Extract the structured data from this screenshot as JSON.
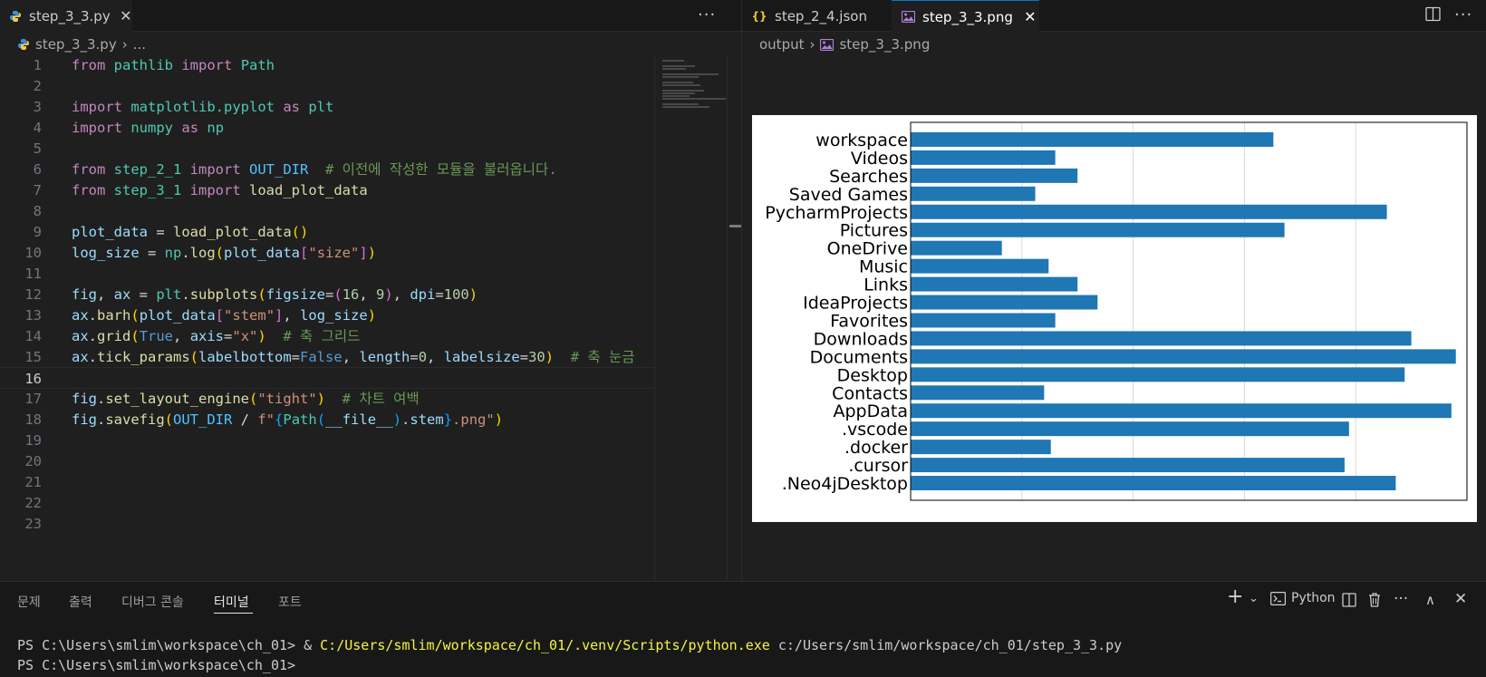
{
  "left_editor": {
    "tab": {
      "filename": "step_3_3.py",
      "icon": "python-file-icon",
      "close_glyph": "✕"
    },
    "more_actions": "···",
    "breadcrumb": {
      "file": "step_3_3.py",
      "trail": "..."
    },
    "lines": [
      {
        "n": "1"
      },
      {
        "n": "2"
      },
      {
        "n": "3"
      },
      {
        "n": "4"
      },
      {
        "n": "5"
      },
      {
        "n": "6"
      },
      {
        "n": "7"
      },
      {
        "n": "8"
      },
      {
        "n": "9"
      },
      {
        "n": "10"
      },
      {
        "n": "11"
      },
      {
        "n": "12"
      },
      {
        "n": "13"
      },
      {
        "n": "14"
      },
      {
        "n": "15"
      },
      {
        "n": "16"
      },
      {
        "n": "17"
      },
      {
        "n": "18"
      },
      {
        "n": "19"
      },
      {
        "n": "20"
      },
      {
        "n": "21"
      },
      {
        "n": "22"
      },
      {
        "n": "23"
      }
    ],
    "active_line": "16",
    "code": {
      "l1": [
        "from",
        " ",
        "pathlib",
        " ",
        "import",
        " ",
        "Path"
      ],
      "l3": [
        "import",
        " ",
        "matplotlib.pyplot",
        " ",
        "as",
        " ",
        "plt"
      ],
      "l4": [
        "import",
        " ",
        "numpy",
        " ",
        "as",
        " ",
        "np"
      ],
      "l6": [
        "from",
        " ",
        "step_2_1",
        " ",
        "import",
        " ",
        "OUT_DIR",
        "  ",
        "# 이전에 작성한 모듈을 불러옵니다."
      ],
      "l7": [
        "from",
        " ",
        "step_3_1",
        " ",
        "import",
        " ",
        "load_plot_data"
      ],
      "l9": [
        "plot_data",
        " = ",
        "load_plot_data",
        "(",
        ")"
      ],
      "l10": [
        "log_size",
        " = ",
        "np",
        ".",
        "log",
        "(",
        "plot_data",
        "[",
        "\"size\"",
        "]",
        ")"
      ],
      "l12": [
        "fig",
        ", ",
        "ax",
        " = ",
        "plt",
        ".",
        "subplots",
        "(",
        "figsize",
        "=",
        "(",
        "16",
        ", ",
        "9",
        ")",
        ", ",
        "dpi",
        "=",
        "100",
        ")"
      ],
      "l13": [
        "ax",
        ".",
        "barh",
        "(",
        "plot_data",
        "[",
        "\"stem\"",
        "]",
        ", ",
        "log_size",
        ")"
      ],
      "l14": [
        "ax",
        ".",
        "grid",
        "(",
        "True",
        ", ",
        "axis",
        "=",
        "\"x\"",
        ")",
        "  ",
        "# 축 그리드"
      ],
      "l15": [
        "ax",
        ".",
        "tick_params",
        "(",
        "labelbottom",
        "=",
        "False",
        ", ",
        "length",
        "=",
        "0",
        ", ",
        "labelsize",
        "=",
        "30",
        ")",
        "  ",
        "# 축 눈금"
      ],
      "l17": [
        "fig",
        ".",
        "set_layout_engine",
        "(",
        "\"tight\"",
        ")",
        "  ",
        "# 차트 여백"
      ],
      "l18": [
        "fig",
        ".",
        "savefig",
        "(",
        "OUT_DIR",
        " / ",
        "f\"",
        "{",
        "Path",
        "(",
        "__file__",
        ")",
        ".stem",
        "}",
        ".png\"",
        ")"
      ]
    }
  },
  "right_editor": {
    "tabs": [
      {
        "label": "step_2_4.json",
        "icon": "json-file-icon",
        "glyph": "{}"
      },
      {
        "label": "step_3_3.png",
        "icon": "image-file-icon",
        "close_glyph": "✕",
        "active": true
      }
    ],
    "more_actions": "···",
    "breadcrumb": {
      "folder": "output",
      "file": "step_3_3.png"
    }
  },
  "chart_data": {
    "type": "bar",
    "orientation": "horizontal",
    "categories": [
      "workspace",
      "Videos",
      "Searches",
      "Saved Games",
      "PycharmProjects",
      "Pictures",
      "OneDrive",
      "Music",
      "Links",
      "IdeaProjects",
      "Favorites",
      "Downloads",
      "Documents",
      "Desktop",
      "Contacts",
      "AppData",
      ".vscode",
      ".docker",
      ".cursor",
      ".Neo4jDesktop"
    ],
    "values": [
      16.3,
      6.5,
      7.5,
      5.6,
      21.4,
      16.8,
      4.1,
      6.2,
      7.5,
      8.4,
      6.5,
      22.5,
      24.5,
      22.2,
      6.0,
      24.3,
      19.7,
      6.3,
      19.5,
      21.8
    ],
    "xlim": [
      0,
      25
    ],
    "grid": "x",
    "tick_label_x_shown": false,
    "bar_color": "#1f77b4",
    "grid_color": "#d9d9d9"
  },
  "panel": {
    "tabs": [
      "문제",
      "출력",
      "디버그 콘솔",
      "터미널",
      "포트"
    ],
    "active_tab": "터미널",
    "controls": {
      "add": "+",
      "dropdown": "⌄",
      "shell_label": "Python",
      "more": "···",
      "maximize": "∧",
      "close": "✕"
    },
    "terminal": {
      "line1_prompt": "PS C:\\Users\\smlim\\workspace\\ch_01> ",
      "line1_amp": "& ",
      "line1_exe": "C:/Users/smlim/workspace/ch_01/.venv/Scripts/python.exe",
      "line1_arg": " c:/Users/smlim/workspace/ch_01/step_3_3.py",
      "line2_prompt": "PS C:\\Users\\smlim\\workspace\\ch_01> "
    }
  }
}
